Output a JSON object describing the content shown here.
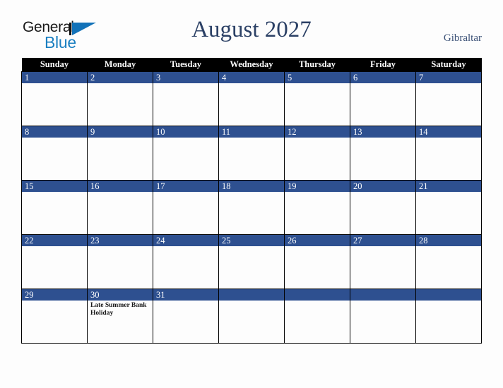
{
  "logo": {
    "word_one": "General",
    "word_two": "Blue",
    "triangle_color": "#1272b8",
    "blue_text_color": "#1a7fc1"
  },
  "header": {
    "title": "August 2027",
    "country": "Gibraltar",
    "title_color": "#2b4065"
  },
  "calendar": {
    "accent_color": "#2e5090",
    "header_bg": "#000000",
    "weekday_headers": [
      "Sunday",
      "Monday",
      "Tuesday",
      "Wednesday",
      "Thursday",
      "Friday",
      "Saturday"
    ],
    "weeks": [
      [
        {
          "day": "1",
          "events": []
        },
        {
          "day": "2",
          "events": []
        },
        {
          "day": "3",
          "events": []
        },
        {
          "day": "4",
          "events": []
        },
        {
          "day": "5",
          "events": []
        },
        {
          "day": "6",
          "events": []
        },
        {
          "day": "7",
          "events": []
        }
      ],
      [
        {
          "day": "8",
          "events": []
        },
        {
          "day": "9",
          "events": []
        },
        {
          "day": "10",
          "events": []
        },
        {
          "day": "11",
          "events": []
        },
        {
          "day": "12",
          "events": []
        },
        {
          "day": "13",
          "events": []
        },
        {
          "day": "14",
          "events": []
        }
      ],
      [
        {
          "day": "15",
          "events": []
        },
        {
          "day": "16",
          "events": []
        },
        {
          "day": "17",
          "events": []
        },
        {
          "day": "18",
          "events": []
        },
        {
          "day": "19",
          "events": []
        },
        {
          "day": "20",
          "events": []
        },
        {
          "day": "21",
          "events": []
        }
      ],
      [
        {
          "day": "22",
          "events": []
        },
        {
          "day": "23",
          "events": []
        },
        {
          "day": "24",
          "events": []
        },
        {
          "day": "25",
          "events": []
        },
        {
          "day": "26",
          "events": []
        },
        {
          "day": "27",
          "events": []
        },
        {
          "day": "28",
          "events": []
        }
      ],
      [
        {
          "day": "29",
          "events": []
        },
        {
          "day": "30",
          "events": [
            "Late Summer Bank Holiday"
          ]
        },
        {
          "day": "31",
          "events": []
        },
        {
          "day": "",
          "events": []
        },
        {
          "day": "",
          "events": []
        },
        {
          "day": "",
          "events": []
        },
        {
          "day": "",
          "events": []
        }
      ]
    ]
  }
}
